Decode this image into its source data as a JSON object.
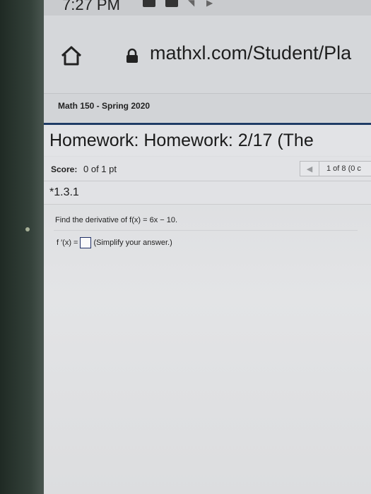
{
  "status_bar": {
    "time": "7:27 PM"
  },
  "browser": {
    "url": "mathxl.com/Student/Pla"
  },
  "course": {
    "title": "Math 150 - Spring 2020"
  },
  "homework": {
    "title": "Homework: Homework: 2/17 (The"
  },
  "score": {
    "label": "Score:",
    "value": "0 of 1 pt"
  },
  "navigation": {
    "position": "1 of 8 (0 c"
  },
  "question": {
    "id": "*1.3.1",
    "prompt": "Find the derivative of f(x) = 6x − 10.",
    "answer_prefix": "f ′(x) =",
    "answer_hint": "(Simplify your answer.)",
    "answer_value": ""
  },
  "icons": {
    "home": "home-icon",
    "lock": "lock-icon",
    "prev": "triangle-left-icon"
  }
}
